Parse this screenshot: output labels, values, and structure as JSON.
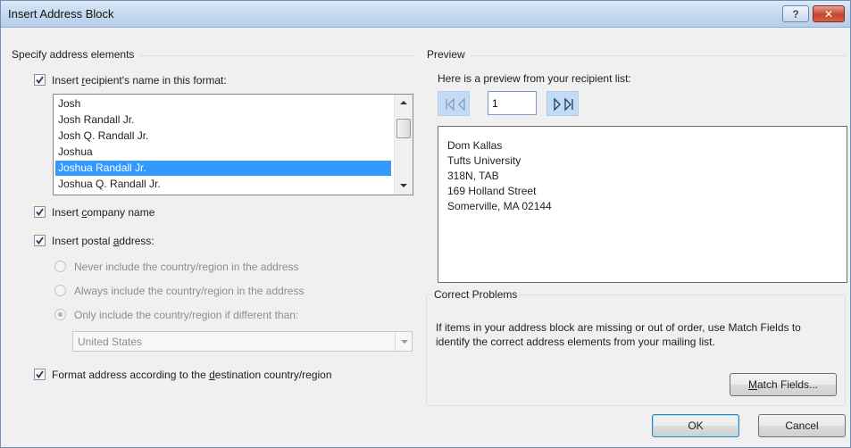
{
  "window": {
    "title": "Insert Address Block",
    "help_glyph": "?",
    "close_glyph": "✕"
  },
  "left": {
    "group_label": "Specify address elements",
    "name_format": {
      "checked": true,
      "label_pre": "Insert ",
      "label_acc": "r",
      "label_post": "ecipient's name in this format:"
    },
    "name_list": [
      "Josh",
      "Josh Randall Jr.",
      "Josh Q. Randall Jr.",
      "Joshua",
      "Joshua Randall Jr.",
      "Joshua Q. Randall Jr."
    ],
    "name_list_selected": "Joshua Randall Jr.",
    "company": {
      "checked": true,
      "label_pre": "Insert ",
      "label_acc": "c",
      "label_post": "ompany name"
    },
    "postal": {
      "checked": true,
      "label_pre": "Insert postal ",
      "label_acc": "a",
      "label_post": "ddress:"
    },
    "country_options": [
      {
        "label": "Never include the country/region in the address",
        "checked": false
      },
      {
        "label": "Always include the country/region in the address",
        "checked": false
      },
      {
        "label": "Only include the country/region if different than:",
        "checked": true
      }
    ],
    "country_select_value": "United States",
    "format_dest": {
      "checked": true,
      "label_pre": "Format address according to the ",
      "label_acc": "d",
      "label_post": "estination country/region"
    }
  },
  "preview": {
    "group_label": "Preview",
    "caption": "Here is a preview from your recipient list:",
    "record_number": "1",
    "address_lines": [
      "Dom Kallas",
      "Tufts University",
      "318N, TAB",
      "169 Holland Street",
      "Somerville, MA 02144"
    ]
  },
  "problems": {
    "title": "Correct Problems",
    "text": "If items in your address block are missing or out of order, use Match Fields to identify the correct address elements from your mailing list.",
    "match_pre": "",
    "match_acc": "M",
    "match_post": "atch Fields..."
  },
  "buttons": {
    "ok": "OK",
    "cancel": "Cancel"
  },
  "colors": {
    "selection": "#3399ff",
    "nav_button": "#c3dbf5",
    "titlebar": "#c5d9ef"
  }
}
